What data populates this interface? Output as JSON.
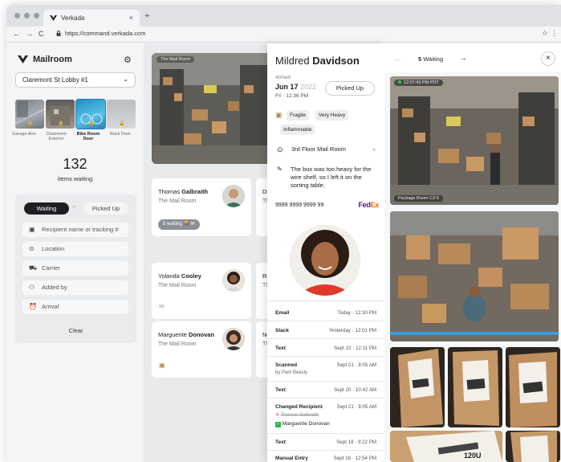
{
  "browser": {
    "tab_title": "Verkada",
    "tab_close": "×",
    "new_tab": "+",
    "back": "←",
    "forward": "→",
    "reload": "C",
    "url": "https://command.verkada.com",
    "star": "☆",
    "menu": "⋮"
  },
  "sidebar": {
    "title": "Mailroom",
    "location": "Claremont St Lobby #1",
    "cameras": [
      "Garage Arm",
      "Claremont Exterior",
      "Bike Room Door",
      "Back Door"
    ],
    "items_count": "132",
    "items_label": "items waiting",
    "toggle_waiting": "Waiting",
    "toggle_picked": "Picked Up",
    "fields": {
      "recipient": "Recipient name or tracking #",
      "location": "Location",
      "carrier": "Carrier",
      "added_by": "Added by",
      "arrival": "Arrival"
    },
    "clear": "Clear"
  },
  "feed": {
    "tag": "The Mail Room"
  },
  "cards": [
    {
      "first": "Thomas ",
      "last": "Galbraith",
      "room": "The Mail Room",
      "pill": "5 waiting"
    },
    {
      "first": "Yolanda ",
      "last": "Cooley",
      "room": "The Mail Room"
    },
    {
      "first": "Marguerite ",
      "last": "Donovan",
      "room": "The Mail Room"
    }
  ],
  "peek_cards": [
    "Der",
    "The",
    "Ray",
    "The",
    "Nel",
    "The"
  ],
  "detail": {
    "first": "Mildred ",
    "last": "Davidson",
    "arrived_label": "Arrived",
    "date": "Jun 17",
    "year": "2022",
    "time": "Fri · 12:36 PM",
    "picked_up": "Picked Up",
    "tags": [
      "Fragile",
      "Very Heavy",
      "Inflammable"
    ],
    "location": "3rd Floor Mail Room",
    "note": "The box was too heavy for the wire shelf, so I left it on the sorting table.",
    "tracking": "9999 9999 9999 99",
    "carrier_a": "Fed",
    "carrier_b": "Ex",
    "history": [
      {
        "label": "Email",
        "time": "Today · 12:30 PM"
      },
      {
        "label": "Slack",
        "time": "Yesterday · 12:01 PM"
      },
      {
        "label": "Text",
        "time": "Sept 22 · 12:11 PM"
      },
      {
        "label": "Scanned",
        "time": "Sept 21 · 9:05 AM",
        "by": "by Pam Beesly"
      },
      {
        "label": "Text",
        "time": "Sept 20 · 10:42 AM"
      },
      {
        "label": "Changed Recipient",
        "time": "Sept 21 · 9:05 AM",
        "old": "Thomas Galbraith",
        "new": "Marguerite Donovan"
      },
      {
        "label": "Text",
        "time": "Sept 19 · 9:22 PM"
      },
      {
        "label": "Manual Entry",
        "time": "Sept 16 · 12:54 PM"
      }
    ]
  },
  "right": {
    "waiting_count": "5",
    "waiting_label": " Waiting",
    "timestamp": "12:07:43 PM PDT",
    "camera_name": "Package Room C3-5",
    "box_text": "120U"
  },
  "colors": {
    "accent": "#1c7bd8",
    "dark": "#1f1f22",
    "fedex_purple": "#4d148c",
    "fedex_orange": "#ff6200"
  }
}
